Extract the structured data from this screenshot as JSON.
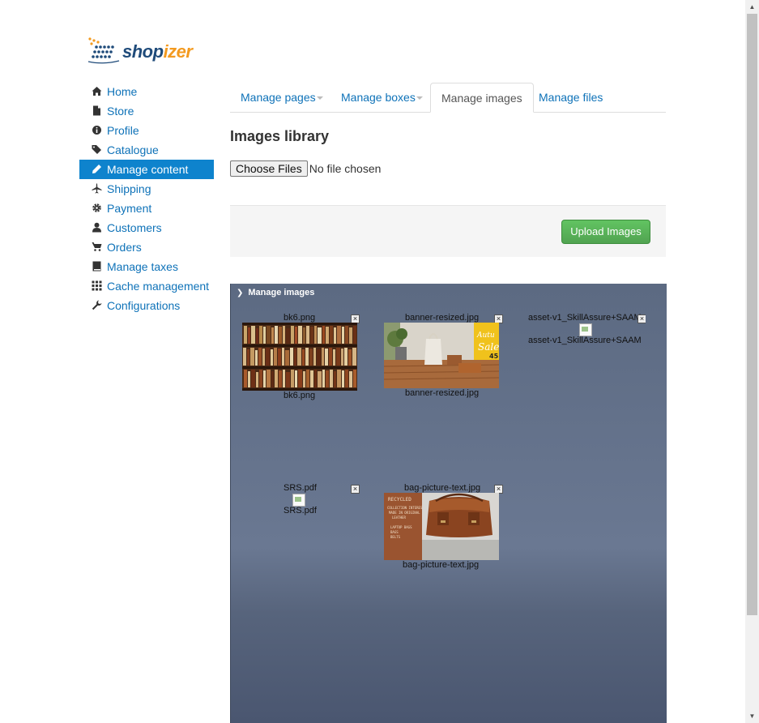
{
  "logo": {
    "part1": "shop",
    "part2": "izer"
  },
  "sidebar": {
    "items": [
      {
        "label": "Home",
        "icon": "home-icon"
      },
      {
        "label": "Store",
        "icon": "file-icon"
      },
      {
        "label": "Profile",
        "icon": "info-icon"
      },
      {
        "label": "Catalogue",
        "icon": "tags-icon"
      },
      {
        "label": "Manage content",
        "icon": "pencil-icon",
        "active": true
      },
      {
        "label": "Shipping",
        "icon": "plane-icon"
      },
      {
        "label": "Payment",
        "icon": "cog-icon"
      },
      {
        "label": "Customers",
        "icon": "user-icon"
      },
      {
        "label": "Orders",
        "icon": "cart-icon"
      },
      {
        "label": "Manage taxes",
        "icon": "book-icon"
      },
      {
        "label": "Cache management",
        "icon": "grid-icon"
      },
      {
        "label": "Configurations",
        "icon": "wrench-icon"
      }
    ]
  },
  "tabs": [
    {
      "label": "Manage pages",
      "dropdown": true
    },
    {
      "label": "Manage boxes",
      "dropdown": true
    },
    {
      "label": "Manage images",
      "active": true
    },
    {
      "label": "Manage files"
    }
  ],
  "page": {
    "title": "Images library",
    "choose_files_label": "Choose Files",
    "file_status": "No file chosen",
    "upload_label": "Upload Images"
  },
  "panel": {
    "title": "Manage images",
    "items": [
      {
        "name": "bk6.png",
        "kind": "image-bookshelf"
      },
      {
        "name": "banner-resized.jpg",
        "kind": "image-banner"
      },
      {
        "name": "asset-v1_SkillAssure+SAAM",
        "name_full": "asset-v1_SkillAssure+SAAM(",
        "kind": "broken"
      },
      {
        "name": "SRS.pdf",
        "kind": "broken"
      },
      {
        "name": "bag-picture-text.jpg",
        "kind": "image-bag"
      }
    ]
  },
  "colors": {
    "link": "#0e72b8",
    "active_nav": "#0e83cd",
    "upload_green": "#5bb75b",
    "panel_bg": "#5c6a82"
  }
}
